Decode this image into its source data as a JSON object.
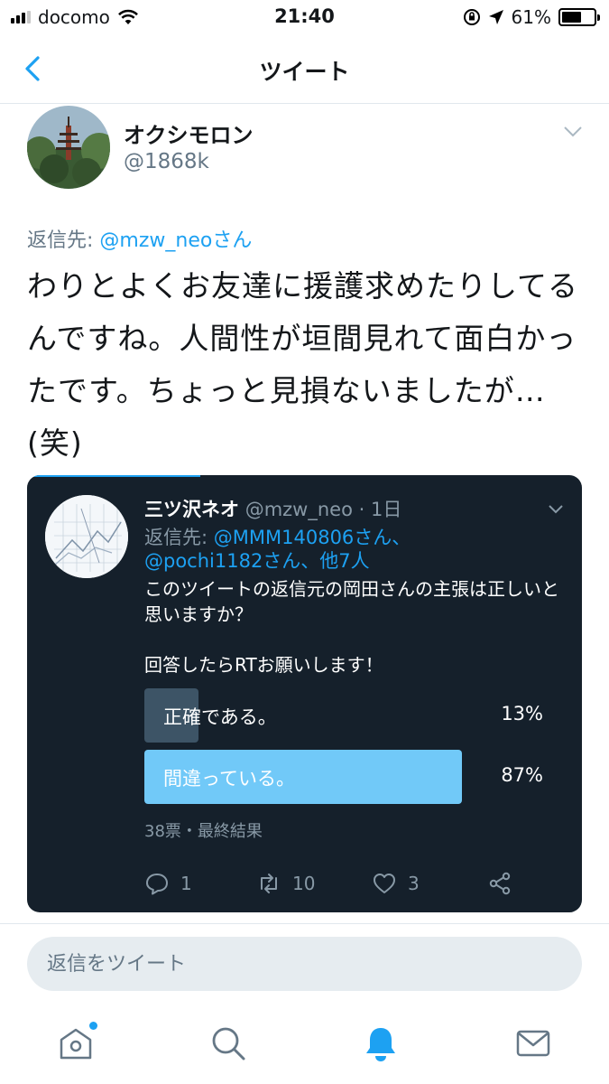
{
  "status_bar": {
    "carrier": "docomo",
    "time": "21:40",
    "battery_percent": "61%",
    "battery_level": 0.61
  },
  "nav": {
    "title": "ツイート"
  },
  "tweet": {
    "display_name": "オクシモロン",
    "handle": "@1868k",
    "reply_prefix": "返信先: ",
    "reply_to": "@mzw_neoさん",
    "text": "わりとよくお友達に援護求めたりしてるんですね。人間性が垣間見れて面白かったです。ちょっと見損ないましたが…(笑)"
  },
  "quoted": {
    "display_name": "三ツ沢ネオ",
    "handle": "@mzw_neo",
    "separator": " · ",
    "time": "1日",
    "reply_prefix": "返信先: ",
    "reply_to": "@MMM140806さん、@pochi1182さん、他7人",
    "text_line1": "このツイートの返信元の岡田さんの主張は正しいと思いますか？",
    "text_line2": "回答したらRTお願いします！",
    "poll": [
      {
        "label": "正確である。",
        "percent": "13%",
        "value": 13,
        "color": "#3d5466"
      },
      {
        "label": "間違っている。",
        "percent": "87%",
        "value": 87,
        "color": "#71c9f8"
      }
    ],
    "poll_result": "38票・最終結果",
    "replies": "1",
    "retweets": "10",
    "likes": "3"
  },
  "reply_bar": {
    "placeholder": "返信をツイート"
  },
  "colors": {
    "accent": "#1da1f2",
    "quote_bg": "#15202b",
    "muted": "#657786"
  },
  "tabs": [
    "home-icon",
    "search-icon",
    "notifications-icon",
    "messages-icon"
  ]
}
